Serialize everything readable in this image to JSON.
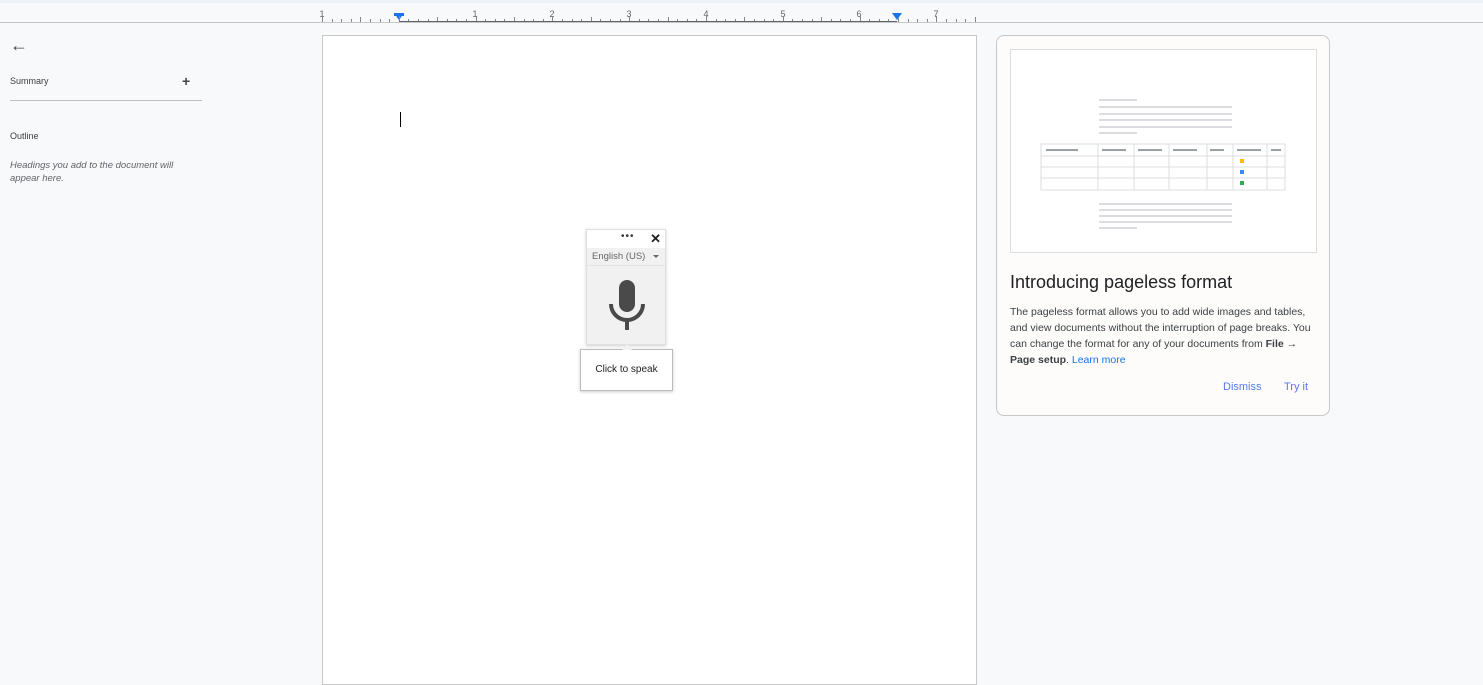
{
  "ruler": {
    "labels": [
      "1",
      "1",
      "2",
      "3",
      "4",
      "5",
      "6",
      "7"
    ]
  },
  "sidebar": {
    "back_label": "←",
    "summary": "Summary",
    "add_label": "+",
    "outline": "Outline",
    "hint": "Headings you add to the document will appear here."
  },
  "voice": {
    "menu": "•••",
    "close": "✕",
    "language": "English (US)",
    "tooltip": "Click to speak"
  },
  "card": {
    "title": "Introducing pageless format",
    "body_1": "The pageless format allows you to add wide images and tables, and view documents without the interruption of page breaks. You can change the format for any of your documents from ",
    "bold": "File → Page setup",
    "body_2": ". ",
    "link": "Learn more",
    "dismiss": "Dismiss",
    "try": "Try it"
  },
  "colors": {
    "accent": "#1a73e8",
    "button": "#5779f0"
  }
}
